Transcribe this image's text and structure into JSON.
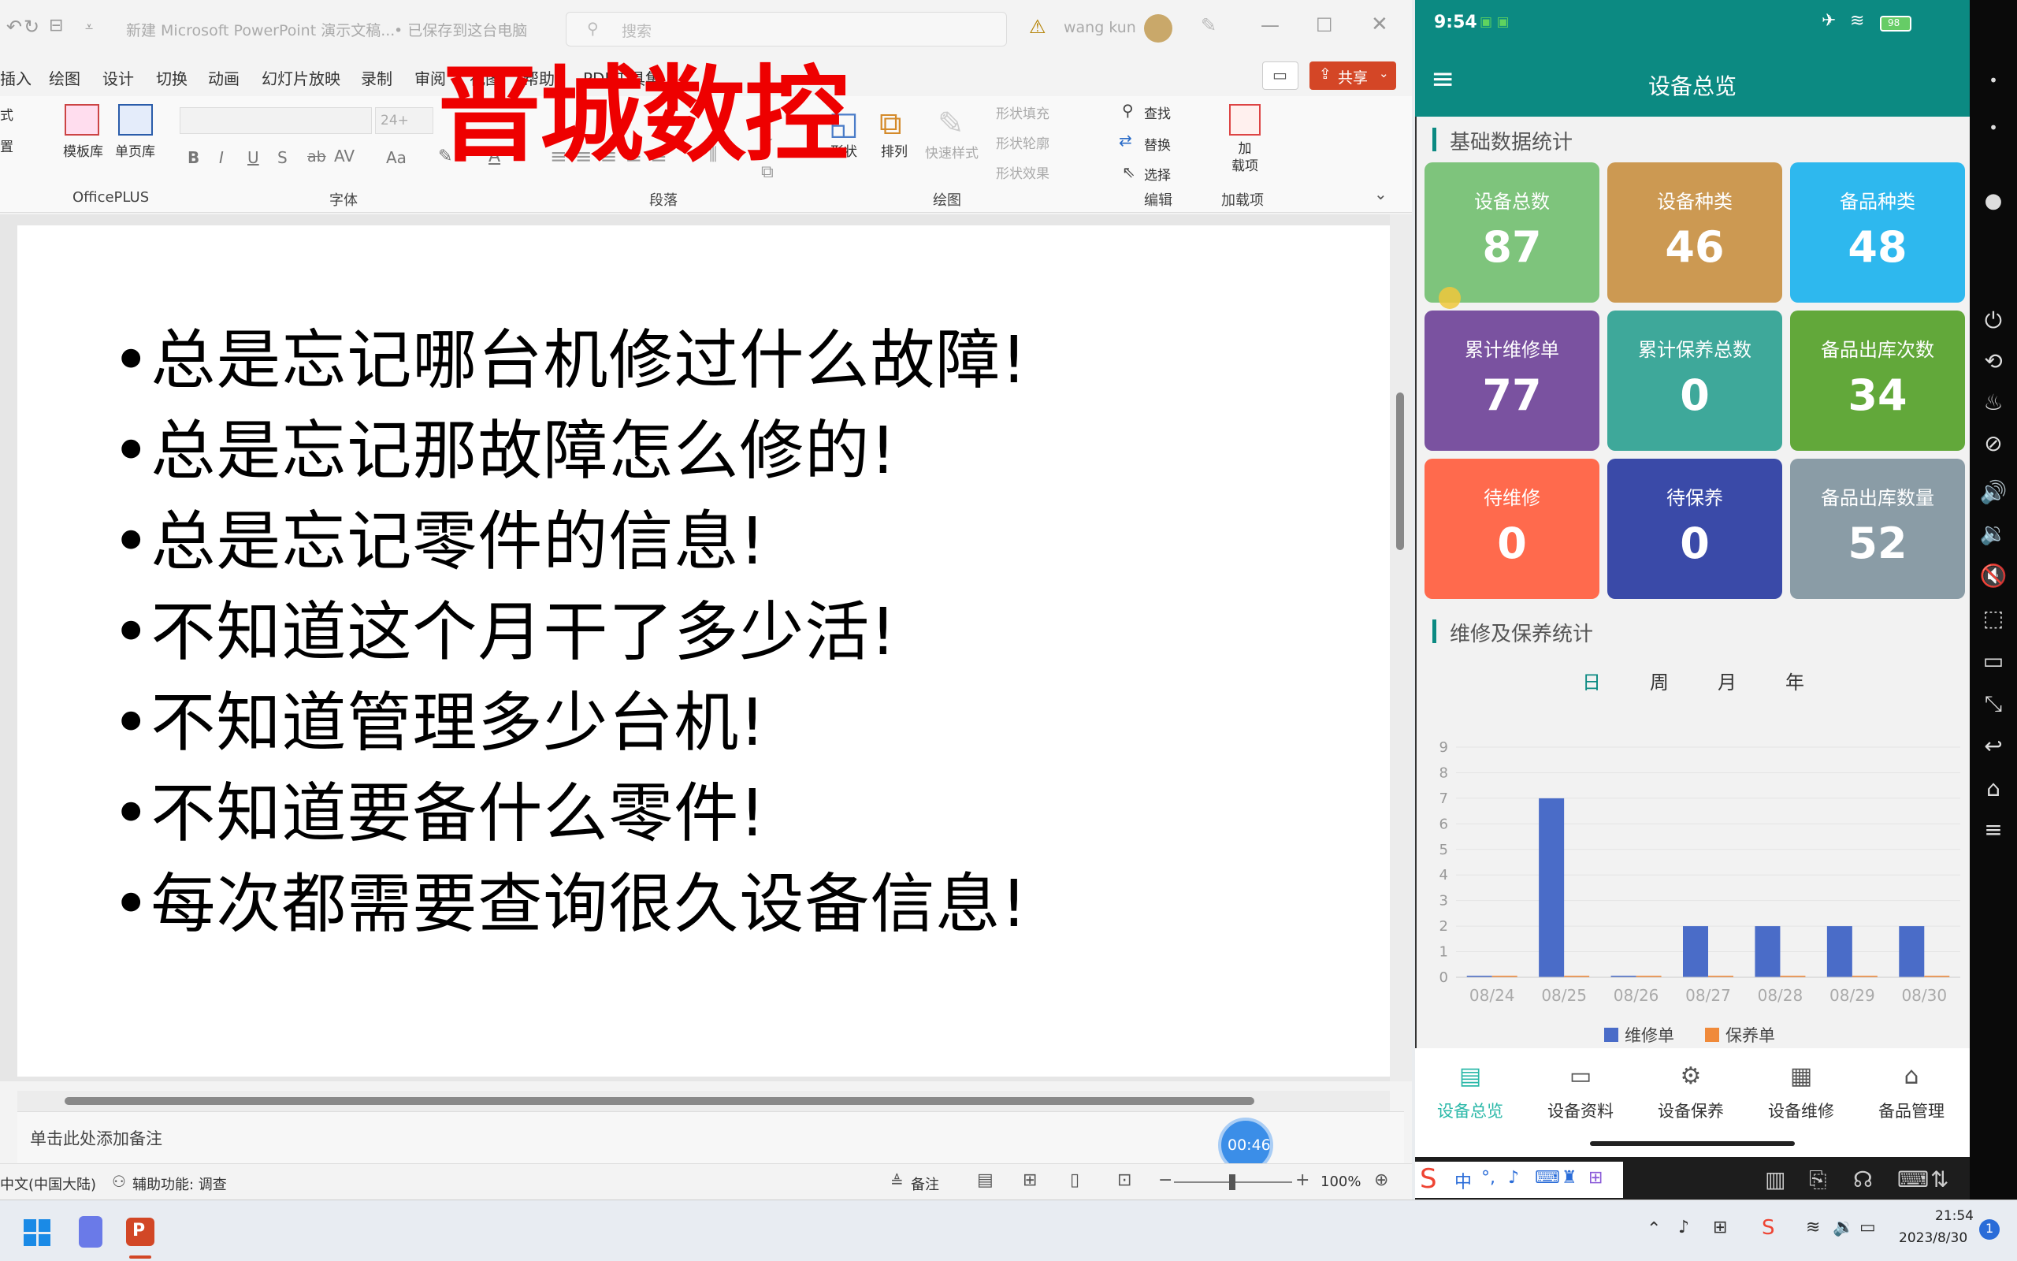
{
  "ppt": {
    "doc_title": "新建 Microsoft PowerPoint 演示文稿...",
    "save_status": "• 已保存到这台电脑",
    "search_placeholder": "搜索",
    "user": "wang kun",
    "share": "共享",
    "menus": [
      "插入",
      "绘图",
      "设计",
      "切换",
      "动画",
      "幻灯片放映",
      "录制",
      "审阅",
      "视图",
      "帮助",
      "PDF工具集"
    ],
    "left_partial": [
      "式",
      "置",
      ""
    ],
    "officeplus": {
      "template": "模板库",
      "single": "单页库",
      "label": "OfficePLUS"
    },
    "font": {
      "name": "",
      "size": "24+",
      "label": "字体"
    },
    "paragraph_label": "段落",
    "drawing": {
      "shape": "形状",
      "arrange": "排列",
      "quick_style": "快速样式",
      "fill": "形状填充",
      "outline": "形状轮廓",
      "effect": "形状效果",
      "label": "绘图"
    },
    "editing": {
      "find": "查找",
      "replace": "替换",
      "select": "选择",
      "label": "编辑"
    },
    "addins": {
      "btn": "加\n载项",
      "label": "加载项"
    },
    "bullets": [
      "•总是忘记哪台机修过什么故障!",
      "•总是忘记那故障怎么修的!",
      "•总是忘记零件的信息!",
      "•不知道这个月干了多少活!",
      "•不知道管理多少台机!",
      "•不知道要备什么零件!",
      "•每次都需要查询很久设备信息!"
    ],
    "notes_placeholder": "单击此处添加备注",
    "status": {
      "lang": "中文(中国大陆)",
      "accessibility": "辅助功能: 调查",
      "notes": "备注",
      "zoom": "100%"
    },
    "timer": "00:46"
  },
  "overlay_logo": "晋城数控",
  "phone": {
    "time": "9:54",
    "battery": "98",
    "title": "设备总览",
    "section1": "基础数据统计",
    "cards": [
      {
        "label": "设备总数",
        "value": "87",
        "color": "#7ec47c"
      },
      {
        "label": "设备种类",
        "value": "46",
        "color": "#cc9952"
      },
      {
        "label": "备品种类",
        "value": "48",
        "color": "#2eb8ee"
      },
      {
        "label": "累计维修单",
        "value": "77",
        "color": "#7a52a0"
      },
      {
        "label": "累计保养总数",
        "value": "0",
        "color": "#3ea89a"
      },
      {
        "label": "备品出库次数",
        "value": "34",
        "color": "#62a83a"
      },
      {
        "label": "待维修",
        "value": "0",
        "color": "#ff6a4d"
      },
      {
        "label": "待保养",
        "value": "0",
        "color": "#3a4aa8"
      },
      {
        "label": "备品出库数量",
        "value": "52",
        "color": "#8a9ca6"
      }
    ],
    "section2": "维修及保养统计",
    "tabs": [
      "日",
      "周",
      "月",
      "年"
    ],
    "active_tab": 0,
    "nav": [
      "设备总览",
      "设备资料",
      "设备保养",
      "设备维修",
      "备品管理"
    ]
  },
  "chart_data": {
    "type": "bar",
    "categories": [
      "08/24",
      "08/25",
      "08/26",
      "08/27",
      "08/28",
      "08/29",
      "08/30"
    ],
    "series": [
      {
        "name": "维修单",
        "values": [
          0,
          7,
          0,
          2,
          2,
          2,
          2
        ],
        "color": "#4a6cc8"
      },
      {
        "name": "保养单",
        "values": [
          0,
          0,
          0,
          0,
          0,
          0,
          0
        ],
        "color": "#f08a3a"
      }
    ],
    "ylim": [
      0,
      9
    ],
    "yticks": [
      "0",
      "1",
      "2",
      "3",
      "4",
      "5",
      "6",
      "7",
      "8",
      "9"
    ],
    "legend": "bottom",
    "grid": true
  },
  "taskbar": {
    "time": "21:54",
    "date": "2023/8/30",
    "badge": "1"
  },
  "ime": {
    "lang": "中"
  }
}
